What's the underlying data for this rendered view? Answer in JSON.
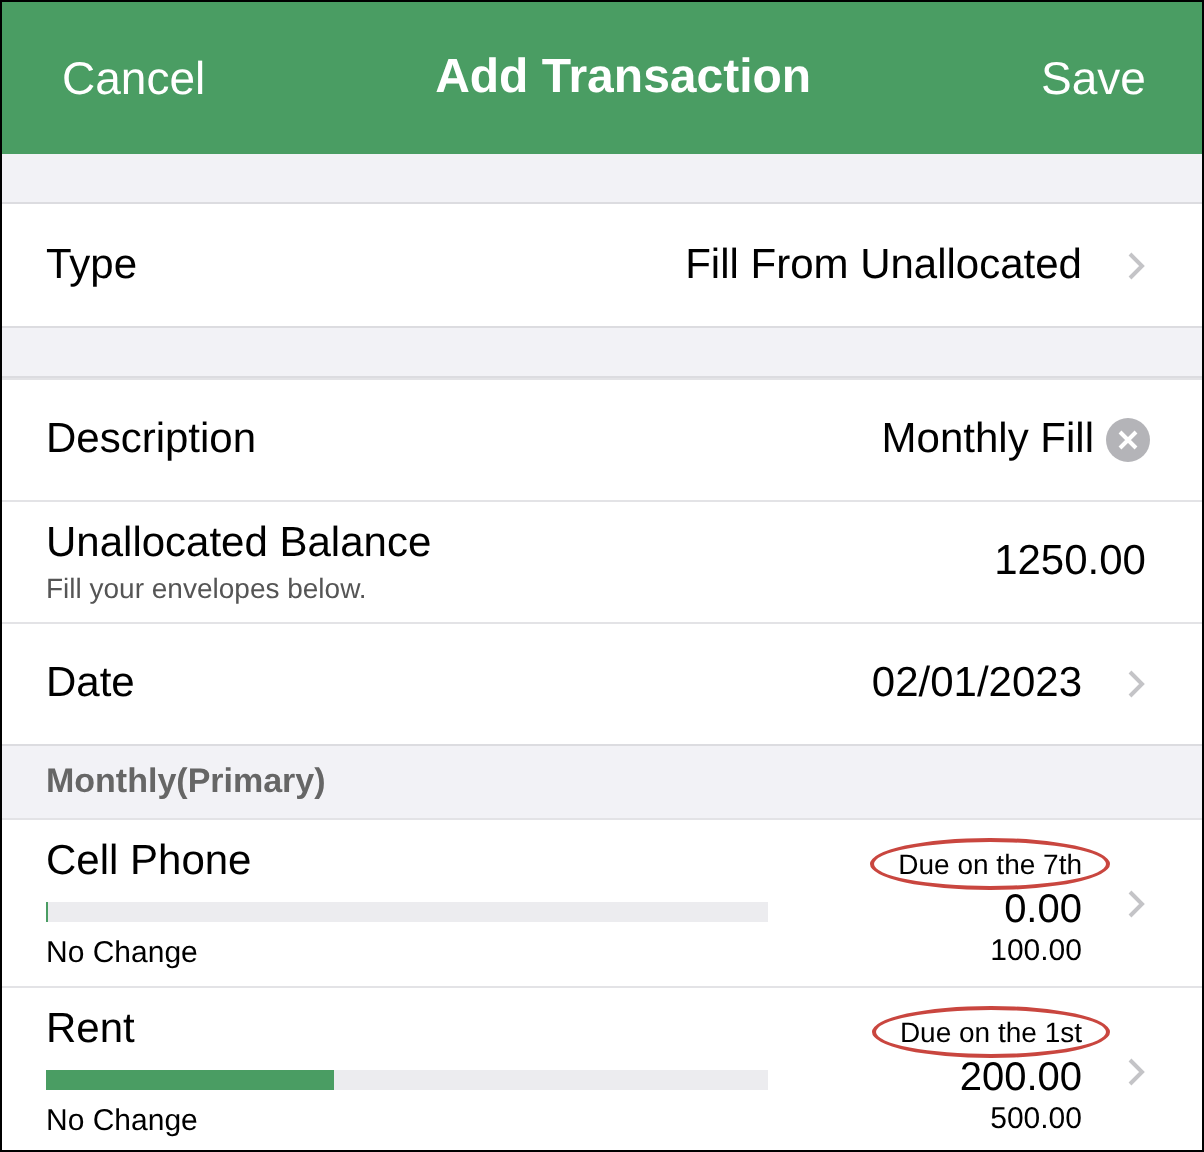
{
  "nav": {
    "cancel": "Cancel",
    "title": "Add Transaction",
    "save": "Save"
  },
  "type_row": {
    "label": "Type",
    "value": "Fill From Unallocated"
  },
  "fields": [
    {
      "kind": "clearable",
      "label": "Description",
      "value": "Monthly Fill"
    },
    {
      "kind": "balance",
      "label": "Unallocated Balance",
      "hint": "Fill your envelopes below.",
      "value": "1250.00"
    },
    {
      "kind": "chevron",
      "label": "Date",
      "value": "02/01/2023"
    }
  ],
  "section": "Monthly(Primary)",
  "envelopes": [
    {
      "name": "Cell Phone",
      "due": "Due on the 7th",
      "amount": "0.00",
      "budget": "100.00",
      "status": "No Change",
      "level": 0
    },
    {
      "name": "Rent",
      "due": "Due on the 1st",
      "amount": "200.00",
      "budget": "500.00",
      "status": "No Change",
      "level": 0.4
    }
  ]
}
